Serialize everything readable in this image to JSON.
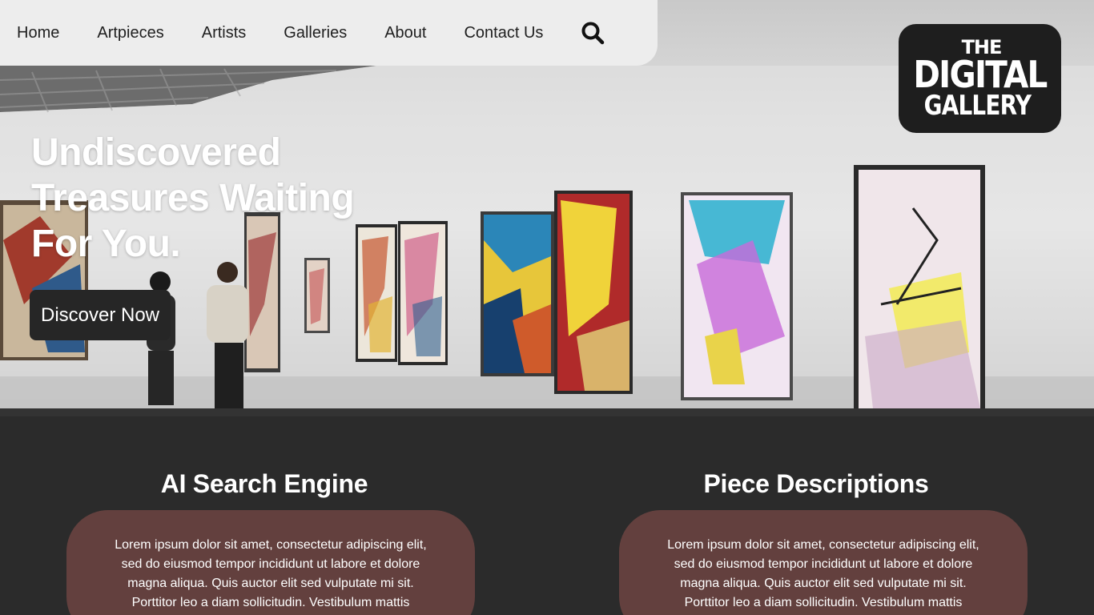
{
  "nav": {
    "items": [
      "Home",
      "Artpieces",
      "Artists",
      "Galleries",
      "About",
      "Contact Us"
    ],
    "search_icon": "search-icon"
  },
  "logo": {
    "line1": "THE",
    "line2": "DIGITAL",
    "line3": "GALLERY"
  },
  "hero": {
    "headline_lines": [
      "Undiscovered",
      "Treasures Waiting",
      "For You."
    ],
    "cta_label": "Discover Now"
  },
  "features": [
    {
      "title": "AI Search Engine",
      "body_lines": [
        "Lorem ipsum dolor sit amet, consectetur adipiscing elit,",
        "sed do eiusmod  tempor incididunt ut labore et dolore",
        "magna aliqua. Quis auctor elit sed  vulputate mi sit.",
        "Porttitor leo a diam sollicitudin. Vestibulum mattis"
      ]
    },
    {
      "title": "Piece Descriptions",
      "body_lines": [
        "Lorem ipsum dolor sit amet, consectetur adipiscing elit,",
        "sed do eiusmod  tempor incididunt ut labore et dolore",
        "magna aliqua. Quis auctor elit sed  vulputate mi sit.",
        "Porttitor leo a diam sollicitudin. Vestibulum mattis"
      ]
    }
  ],
  "colors": {
    "nav_bg": "#ededed",
    "logo_bg": "#1e1e1e",
    "cta_bg": "#262626",
    "section_bg": "#2b2b2b",
    "card_bg": "#63403e"
  }
}
